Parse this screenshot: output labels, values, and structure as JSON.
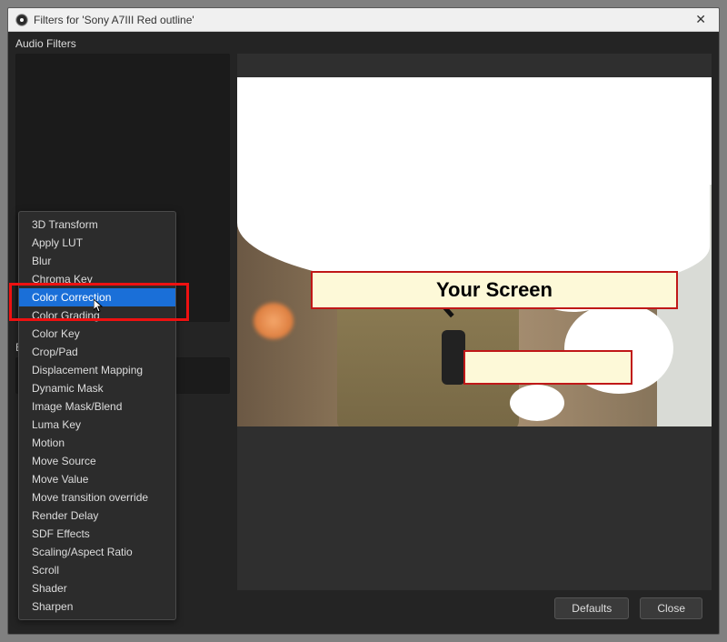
{
  "titlebar": {
    "title": "Filters for 'Sony A7III Red outline'"
  },
  "sections": {
    "audio_filters": "Audio Filters",
    "effect_filters": "E"
  },
  "context_menu": {
    "highlight_index": 4,
    "items": [
      "3D Transform",
      "Apply LUT",
      "Blur",
      "Chroma Key",
      "Color Correction",
      "Color Grading",
      "Color Key",
      "Crop/Pad",
      "Displacement Mapping",
      "Dynamic Mask",
      "Image Mask/Blend",
      "Luma Key",
      "Motion",
      "Move Source",
      "Move Value",
      "Move transition override",
      "Render Delay",
      "SDF Effects",
      "Scaling/Aspect Ratio",
      "Scroll",
      "Shader",
      "Sharpen"
    ]
  },
  "overlays": {
    "your_screen": "Your Screen",
    "second": ""
  },
  "footer": {
    "defaults": "Defaults",
    "close": "Close"
  }
}
